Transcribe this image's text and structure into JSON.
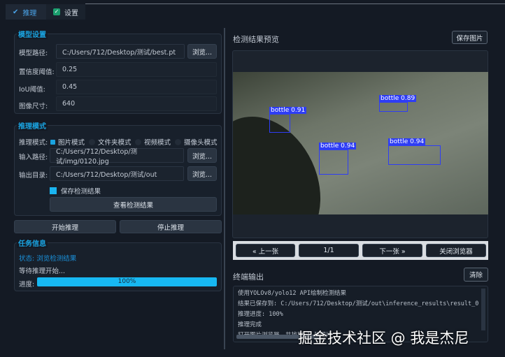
{
  "tabs": [
    {
      "label": "推理"
    },
    {
      "label": "设置"
    }
  ],
  "model": {
    "title": "模型设置",
    "path_label": "模型路径:",
    "path_value": "C:/Users/712/Desktop/测试/best.pt",
    "browse": "浏览...",
    "conf_label": "置信度阈值:",
    "conf_value": "0.25",
    "iou_label": "IoU阈值:",
    "iou_value": "0.45",
    "size_label": "图像尺寸:",
    "size_value": "640"
  },
  "mode": {
    "title": "推理模式",
    "label": "推理模式:",
    "options": [
      "图片模式",
      "文件夹模式",
      "视频模式",
      "摄像头模式"
    ],
    "input_label": "输入路径:",
    "input_value": "C:/Users/712/Desktop/测试/img/0120.jpg",
    "output_label": "输出目录:",
    "output_value": "C:/Users/712/Desktop/测试/out",
    "browse": "浏览...",
    "save_label": "保存检测结果",
    "view_results": "查看检测结果"
  },
  "actions": {
    "start": "开始推理",
    "stop": "停止推理"
  },
  "task": {
    "title": "任务信息",
    "status": "状态: 浏览检测结果",
    "message": "等待推理开始...",
    "progress_label": "进度:",
    "progress": 100,
    "progress_text": "100%"
  },
  "preview": {
    "title": "检测结果预览",
    "save": "保存图片",
    "detections": [
      {
        "label": "bottle 0.91"
      },
      {
        "label": "bottle 0.89"
      },
      {
        "label": "bottle 0.94"
      },
      {
        "label": "bottle 0.94"
      }
    ],
    "prev": "« 上一张",
    "page": "1/1",
    "next": "下一张 »",
    "close": "关闭浏览器"
  },
  "terminal": {
    "title": "终端输出",
    "clear": "清除",
    "lines": [
      "使用YOLOv8/yolo12 API绘制检测结果",
      "结果已保存到: C:/Users/712/Desktop/测试/out\\inference_results\\result_0",
      "推理进度: 100%",
      "推理完成",
      "打开图片浏览器，共找到 1 张图片"
    ]
  },
  "watermark": "掘金技术社区 @ 我是杰尼"
}
